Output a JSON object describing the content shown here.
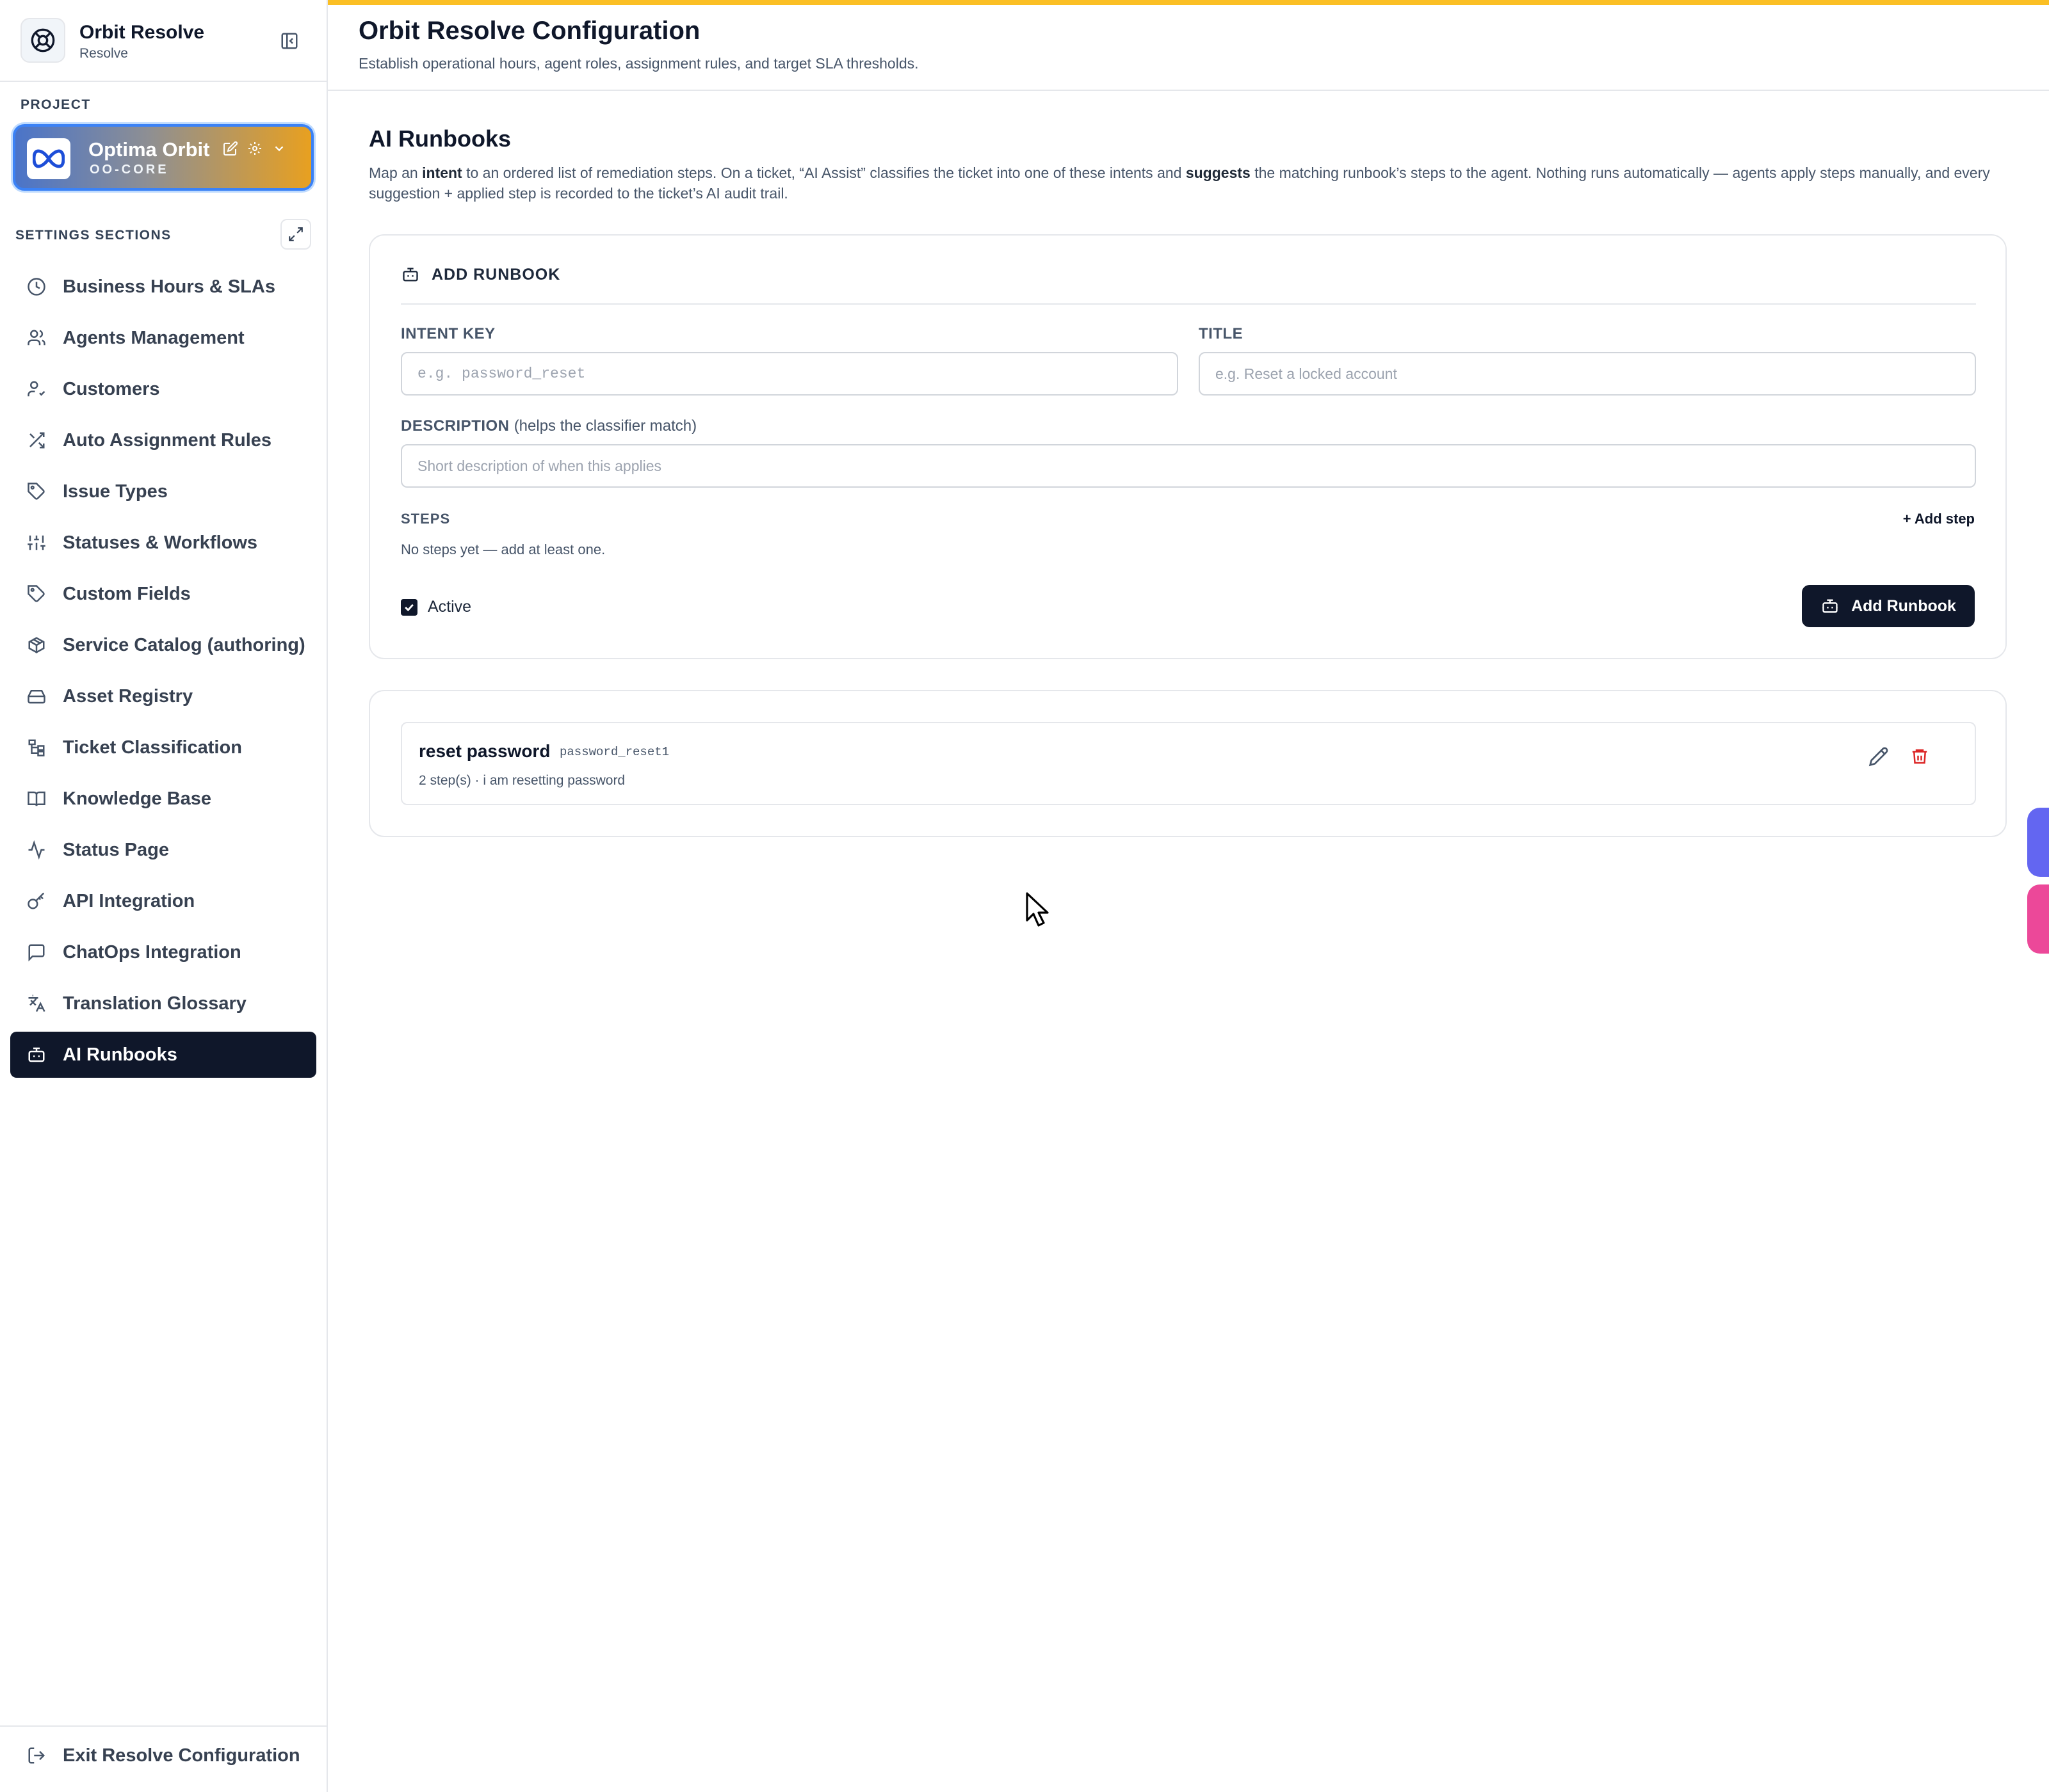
{
  "app": {
    "name": "Orbit Resolve",
    "subtitle": "Resolve"
  },
  "sidebar": {
    "project_label": "PROJECT",
    "project": {
      "name": "Optima Orbit",
      "key": "OO-CORE"
    },
    "sections_label": "SETTINGS SECTIONS",
    "items": [
      {
        "label": "Business Hours & SLAs",
        "icon": "clock-icon"
      },
      {
        "label": "Agents Management",
        "icon": "users-icon"
      },
      {
        "label": "Customers",
        "icon": "user-check-icon"
      },
      {
        "label": "Auto Assignment Rules",
        "icon": "shuffle-icon"
      },
      {
        "label": "Issue Types",
        "icon": "tag-icon"
      },
      {
        "label": "Statuses & Workflows",
        "icon": "sliders-icon"
      },
      {
        "label": "Custom Fields",
        "icon": "tag-icon"
      },
      {
        "label": "Service Catalog (authoring)",
        "icon": "package-icon"
      },
      {
        "label": "Asset Registry",
        "icon": "hard-drive-icon"
      },
      {
        "label": "Ticket Classification",
        "icon": "tree-icon"
      },
      {
        "label": "Knowledge Base",
        "icon": "book-icon"
      },
      {
        "label": "Status Page",
        "icon": "activity-icon"
      },
      {
        "label": "API Integration",
        "icon": "key-icon"
      },
      {
        "label": "ChatOps Integration",
        "icon": "message-square-icon"
      },
      {
        "label": "Translation Glossary",
        "icon": "languages-icon"
      },
      {
        "label": "AI Runbooks",
        "icon": "bot-icon",
        "active": true
      }
    ],
    "exit_label": "Exit Resolve Configuration"
  },
  "header": {
    "title": "Orbit Resolve Configuration",
    "subtitle": "Establish operational hours, agent roles, assignment rules, and target SLA thresholds."
  },
  "section": {
    "title": "AI Runbooks",
    "desc_parts": [
      "Map an ",
      "intent",
      " to an ordered list of remediation steps. On a ticket, “AI Assist” classifies the ticket into one of these intents and ",
      "suggests",
      " the matching runbook’s steps to the agent. Nothing runs automatically — agents apply steps manually, and every suggestion + applied step is recorded to the ticket’s AI audit trail."
    ]
  },
  "form": {
    "heading": "ADD RUNBOOK",
    "intent_label": "INTENT KEY",
    "intent_placeholder": "e.g. password_reset",
    "title_label": "TITLE",
    "title_placeholder": "e.g. Reset a locked account",
    "desc_label": "DESCRIPTION",
    "desc_hint": "(helps the classifier match)",
    "desc_placeholder": "Short description of when this applies",
    "steps_label": "STEPS",
    "add_step": "+ Add step",
    "no_steps": "No steps yet — add at least one.",
    "active_label": "Active",
    "active_checked": true,
    "submit": "Add Runbook"
  },
  "runbooks": [
    {
      "title": "reset password",
      "key": "password_reset1",
      "meta": "2 step(s) · i am resetting password"
    }
  ],
  "colors": {
    "accent_bar": "#fbbf24",
    "primary": "#0f172a",
    "danger": "#dc2626",
    "fab_indigo": "#6366f1",
    "fab_pink": "#ec4899"
  }
}
